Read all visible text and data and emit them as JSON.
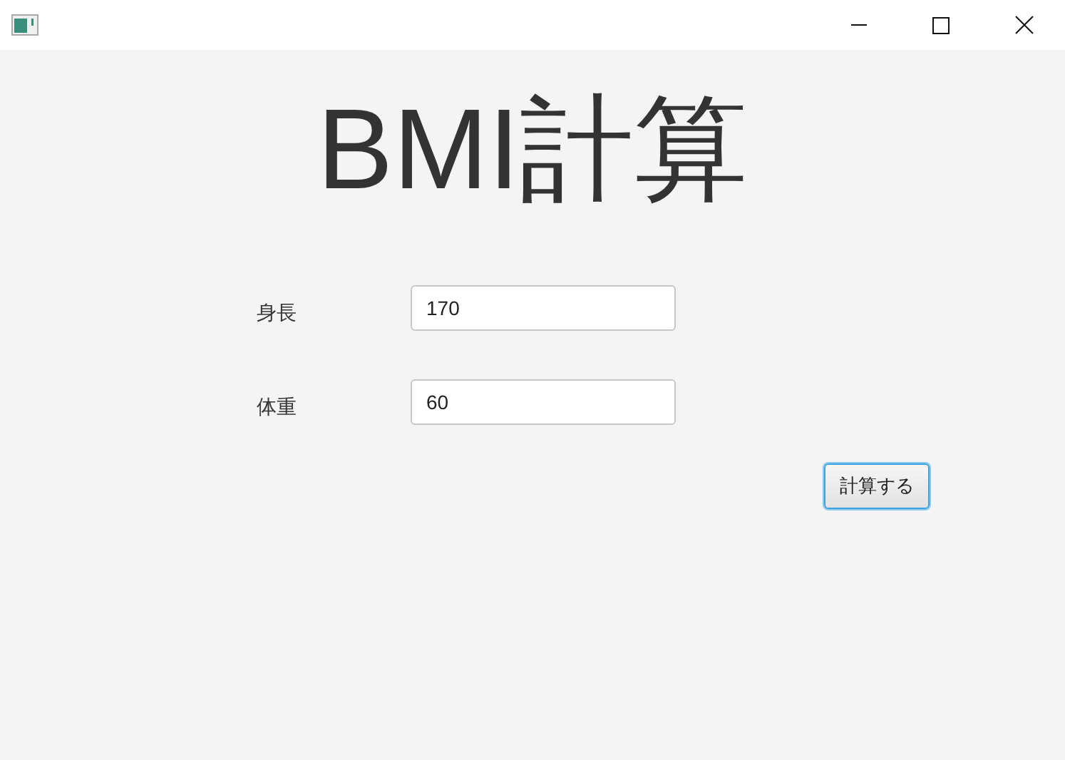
{
  "title": "BMI計算",
  "fields": [
    {
      "label": "身長",
      "value": "170"
    },
    {
      "label": "体重",
      "value": "60"
    }
  ],
  "button": {
    "label": "計算する",
    "focused": true
  }
}
